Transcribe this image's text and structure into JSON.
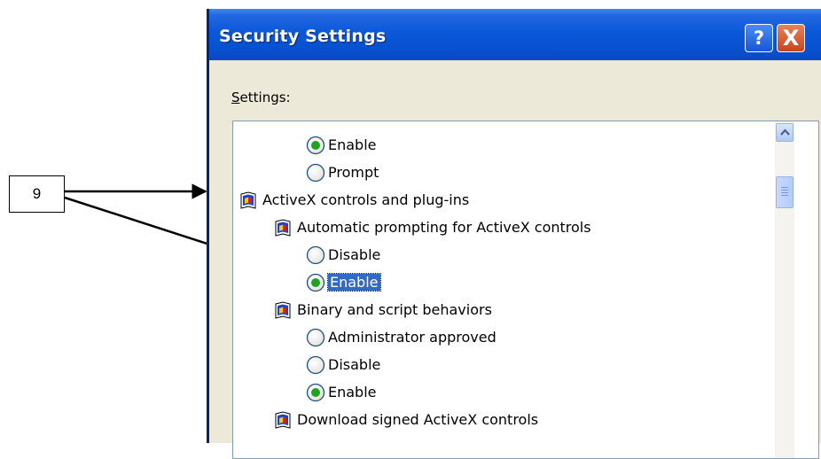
{
  "callout": {
    "number": "9"
  },
  "window": {
    "title": "Security Settings",
    "help_button": "?",
    "close_button": "X",
    "settings_label": "Settings:",
    "settings_accesskey": "S",
    "settings_rest": "ettings:"
  },
  "tree": [
    {
      "type": "radio",
      "label": "Enable",
      "checked": true
    },
    {
      "type": "radio",
      "label": "Prompt",
      "checked": false
    },
    {
      "type": "category",
      "label": "ActiveX controls and plug-ins"
    },
    {
      "type": "setting",
      "label": "Automatic prompting for ActiveX controls"
    },
    {
      "type": "radio",
      "label": "Disable",
      "checked": false
    },
    {
      "type": "radio",
      "label": "Enable",
      "checked": true,
      "selected": true
    },
    {
      "type": "setting",
      "label": "Binary and script behaviors"
    },
    {
      "type": "radio",
      "label": "Administrator approved",
      "checked": false
    },
    {
      "type": "radio",
      "label": "Disable",
      "checked": false
    },
    {
      "type": "radio",
      "label": "Enable",
      "checked": true
    },
    {
      "type": "setting",
      "label": "Download signed ActiveX controls"
    }
  ],
  "icons": {
    "radio": "radio-icon",
    "folder": "settings-folder-icon",
    "help": "help-icon",
    "close": "close-icon",
    "scroll_up": "scroll-up-arrow-icon"
  },
  "colors": {
    "titlebar": "#0850d0",
    "selection": "#316ac5",
    "radio_dot": "#21a121",
    "close_button": "#c8441c"
  }
}
